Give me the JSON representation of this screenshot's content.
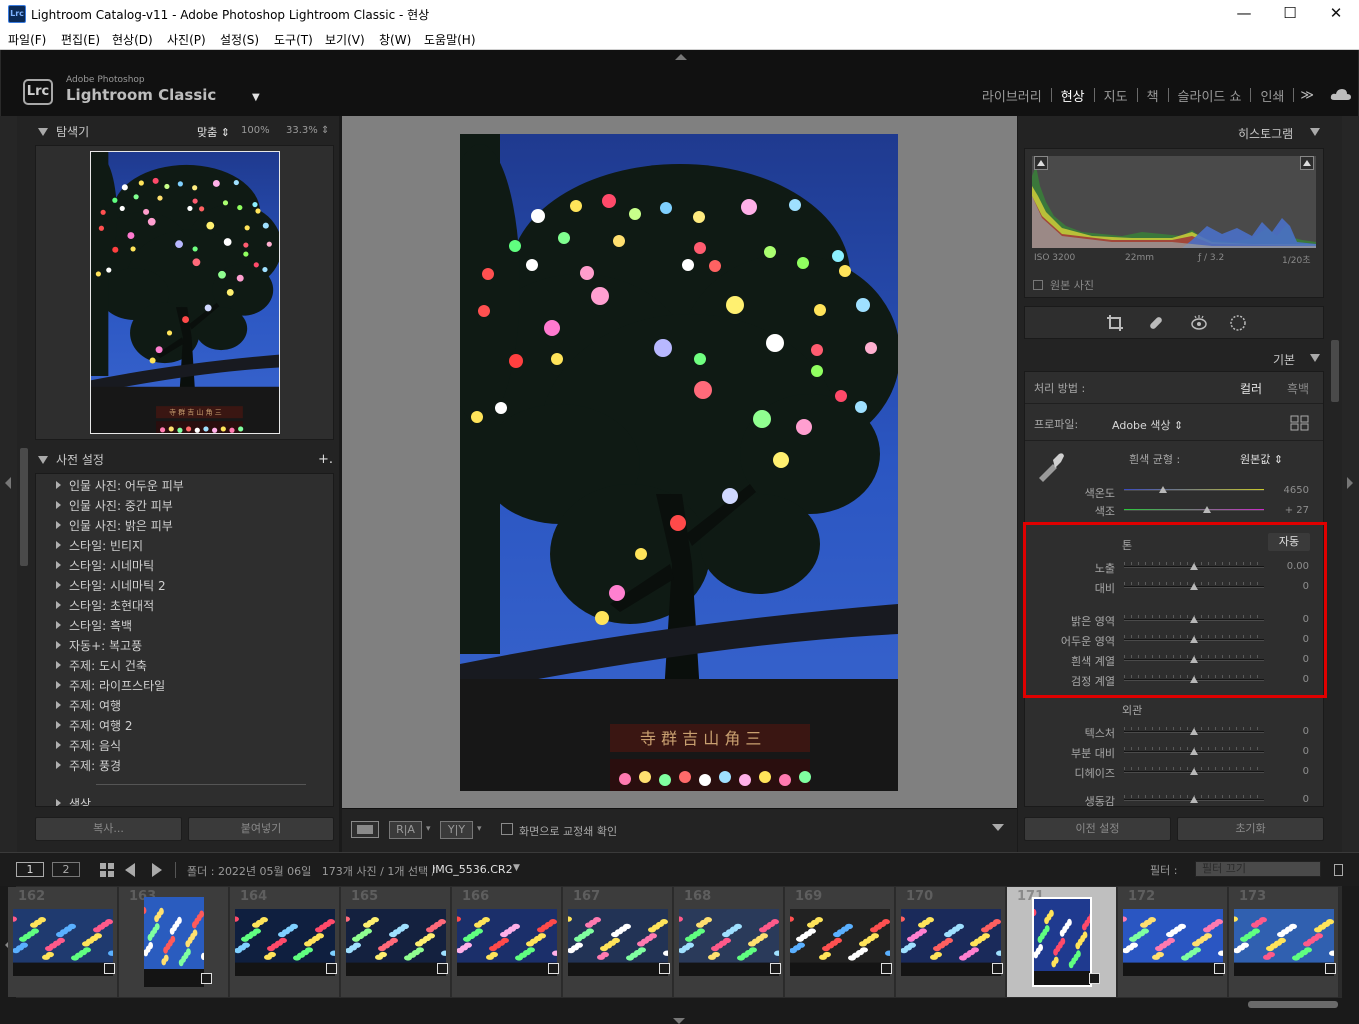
{
  "window": {
    "app_icon_text": "Lrc",
    "title": "Lightroom Catalog-v11 - Adobe Photoshop Lightroom Classic - 현상",
    "minimize_glyph": "—",
    "maximize_glyph": "☐",
    "close_glyph": "✕"
  },
  "menu": [
    "파일(F)",
    "편집(E)",
    "현상(D)",
    "사진(P)",
    "설정(S)",
    "도구(T)",
    "보기(V)",
    "창(W)",
    "도움말(H)"
  ],
  "identity": {
    "badge": "Lrc",
    "small": "Adobe Photoshop",
    "big": "Lightroom Classic",
    "caret": "▼"
  },
  "modules": {
    "items": [
      "라이브러리",
      "현상",
      "지도",
      "책",
      "슬라이드 쇼",
      "인쇄"
    ],
    "active": "현상",
    "more": "≫"
  },
  "navigator": {
    "title": "탐색기",
    "zoom_fit": "맞춤 ⇕",
    "zoom_100": "100%",
    "zoom_333": "33.3% ⇕"
  },
  "presets": {
    "title": "사전 설정",
    "add": "+.",
    "items": [
      "인물 사진: 어두운 피부",
      "인물 사진: 중간 피부",
      "인물 사진: 밝은 피부",
      "스타일: 빈티지",
      "스타일: 시네마틱",
      "스타일: 시네마틱 2",
      "스타일: 초현대적",
      "스타일: 흑백",
      "자동+: 복고풍",
      "주제: 도시 건축",
      "주제: 라이프스타일",
      "주제: 여행",
      "주제: 여행 2",
      "주제: 음식",
      "주제: 풍경",
      "색상"
    ]
  },
  "left_buttons": {
    "copy": "복사...",
    "paste": "붙여넣기"
  },
  "toolbar": {
    "view_ra": "R|A",
    "view_yy": "Y|Y",
    "softproof": "화면으로 교정쇄 확인"
  },
  "histogram": {
    "title": "히스토그램",
    "iso": "ISO 3200",
    "focal": "22mm",
    "aperture": "ƒ / 3.2",
    "shutter": "1/20초",
    "original_photo": "원본 사진"
  },
  "basic": {
    "title": "기본",
    "treatment_label": "처리 방법 :",
    "treatment_color": "컬러",
    "treatment_bw": "흑백",
    "profile_label": "프로파일:",
    "profile_value": "Adobe 색상 ⇕",
    "wb_label": "흰색 균형 :",
    "wb_value": "원본값 ⇕",
    "temp": {
      "label": "색온도",
      "value": "4650",
      "position": 0.28
    },
    "tint": {
      "label": "색조",
      "value": "+ 27",
      "position": 0.59
    },
    "tone_title": "톤",
    "auto": "자동",
    "tone": [
      {
        "label": "노출",
        "value": "0.00",
        "position": 0.5
      },
      {
        "label": "대비",
        "value": "0",
        "position": 0.5
      },
      {
        "label": "밝은 영역",
        "value": "0",
        "position": 0.5
      },
      {
        "label": "어두운 영역",
        "value": "0",
        "position": 0.5
      },
      {
        "label": "흰색 계열",
        "value": "0",
        "position": 0.5
      },
      {
        "label": "검정 계열",
        "value": "0",
        "position": 0.5
      }
    ],
    "presence_title": "외관",
    "presence": [
      {
        "label": "텍스처",
        "value": "0",
        "position": 0.5
      },
      {
        "label": "부분 대비",
        "value": "0",
        "position": 0.5
      },
      {
        "label": "디헤이즈",
        "value": "0",
        "position": 0.5
      },
      {
        "label": "생동감",
        "value": "0",
        "position": 0.5
      }
    ]
  },
  "right_buttons": {
    "previous": "이전 설정",
    "reset": "초기화"
  },
  "filmbar": {
    "screen1": "1",
    "screen2": "2",
    "path": "폴더 : 2022년 05월 06일   173개 사진 / 1개 선택 /",
    "filename": "IMG_5536.CR2",
    "filter_label": "필터 :",
    "filter_value": "필터 끄기"
  },
  "filmstrip": [
    {
      "num": "162"
    },
    {
      "num": "163"
    },
    {
      "num": "164"
    },
    {
      "num": "165"
    },
    {
      "num": "166"
    },
    {
      "num": "167"
    },
    {
      "num": "168"
    },
    {
      "num": "169"
    },
    {
      "num": "170"
    },
    {
      "num": "171",
      "selected": true
    },
    {
      "num": "172"
    },
    {
      "num": "173"
    }
  ],
  "colors": {
    "active_module": "#ffffff",
    "highlight_box": "#e00000",
    "panel_bg": "#2e2e2e",
    "canvas_bg": "#808080"
  }
}
